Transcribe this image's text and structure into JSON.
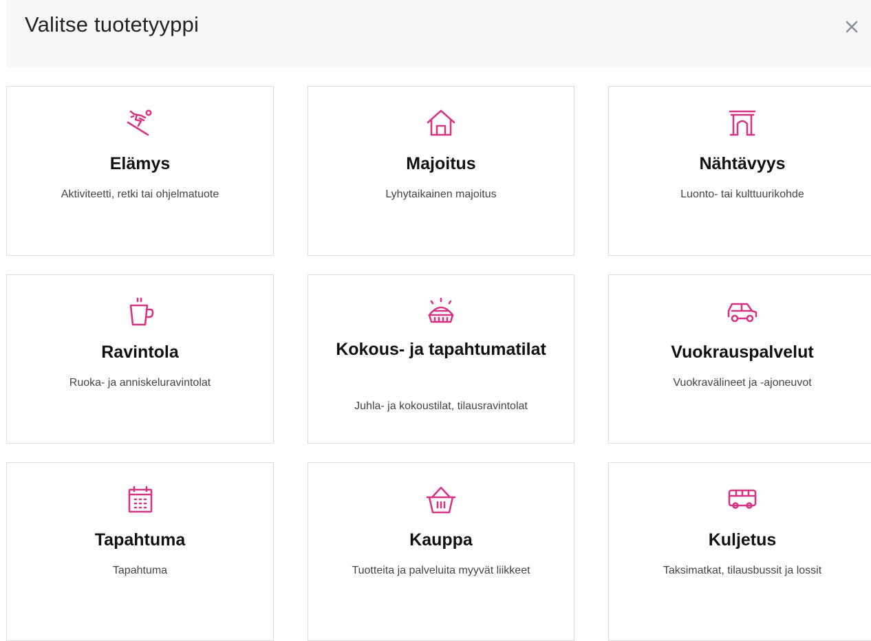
{
  "dialog": {
    "title": "Valitse tuotetyyppi",
    "close_label": "×"
  },
  "accent_color": "#d63384",
  "cards": [
    {
      "name": "Elämys",
      "description": "Aktiviteetti, retki tai ohjelmatuote",
      "icon": "skier-icon"
    },
    {
      "name": "Majoitus",
      "description": "Lyhytaikainen majoitus",
      "icon": "house-icon"
    },
    {
      "name": "Nähtävyys",
      "description": "Luonto- tai kulttuurikohde",
      "icon": "gate-icon"
    },
    {
      "name": "Ravintola",
      "description": "Ruoka- ja anniskeluravintolat",
      "icon": "coffee-cup-icon"
    },
    {
      "name": "Kokous- ja tapahtumatilat",
      "description": "Juhla- ja kokoustilat, tilausravintolat",
      "icon": "venue-icon"
    },
    {
      "name": "Vuokrauspalvelut",
      "description": "Vuokravälineet ja -ajoneuvot",
      "icon": "car-icon"
    },
    {
      "name": "Tapahtuma",
      "description": "Tapahtuma",
      "icon": "calendar-icon"
    },
    {
      "name": "Kauppa",
      "description": "Tuotteita ja palveluita myyvät liikkeet",
      "icon": "basket-icon"
    },
    {
      "name": "Kuljetus",
      "description": "Taksimatkat, tilausbussit ja lossit",
      "icon": "bus-icon"
    }
  ]
}
